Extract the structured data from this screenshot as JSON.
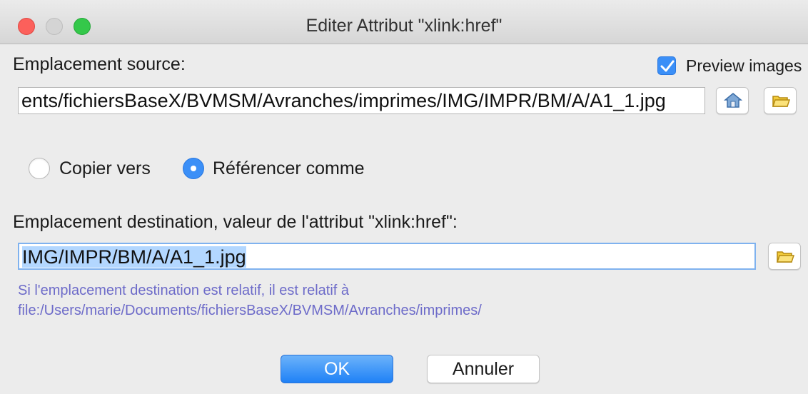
{
  "window": {
    "title": "Editer Attribut \"xlink:href\""
  },
  "source": {
    "label": "Emplacement source:",
    "preview_label": "Preview images",
    "preview_checked": true,
    "path_value": "ents/fichiersBaseX/BVMSM/Avranches/imprimes/IMG/IMPR/BM/A/A1_1.jpg",
    "home_button_icon": "home-icon",
    "browse_button_icon": "folder-icon"
  },
  "mode": {
    "copy_label": "Copier vers",
    "reference_label": "Référencer comme",
    "selected": "reference"
  },
  "destination": {
    "label": "Emplacement destination, valeur de l'attribut \"xlink:href\":",
    "value": "IMG/IMPR/BM/A/A1_1.jpg",
    "browse_button_icon": "folder-icon",
    "info_line1": "Si l'emplacement destination est relatif, il est relatif à",
    "info_line2": "file:/Users/marie/Documents/fichiersBaseX/BVMSM/Avranches/imprimes/"
  },
  "buttons": {
    "ok_label": "OK",
    "cancel_label": "Annuler"
  },
  "colors": {
    "accent": "#3b8ff7",
    "info_text": "#6d6bc9",
    "selection": "#b3d7ff"
  }
}
